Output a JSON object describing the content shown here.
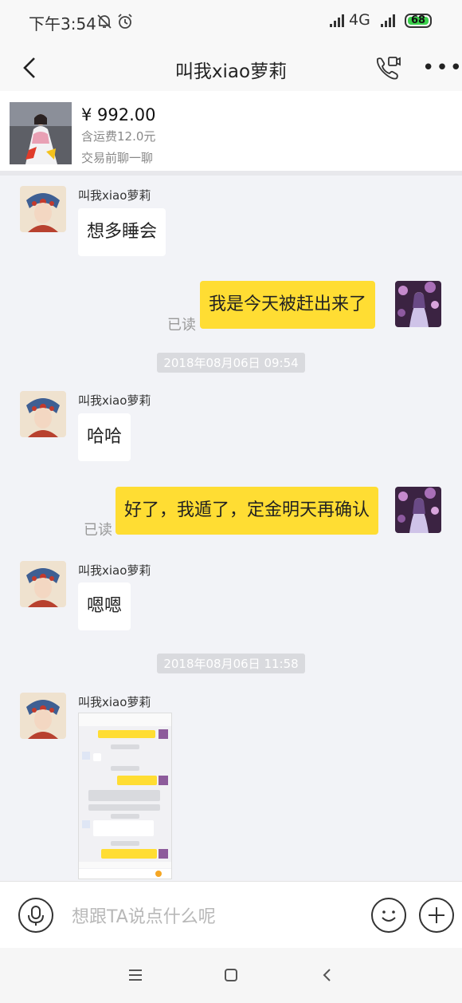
{
  "status_bar": {
    "time": "下午3:54",
    "network": "4G",
    "battery": "68"
  },
  "header": {
    "title": "叫我xiao萝莉"
  },
  "product": {
    "price": "¥ 992.00",
    "shipping": "含运费12.0元",
    "prompt": "交易前聊一聊"
  },
  "messages": [
    {
      "from": "other",
      "sender": "叫我xiao萝莉",
      "text": "想多睡会"
    },
    {
      "from": "me",
      "text": "我是今天被赶出来了",
      "status": "已读"
    },
    {
      "timestamp": "2018年08月06日 09:54"
    },
    {
      "from": "other",
      "sender": "叫我xiao萝莉",
      "text": "哈哈"
    },
    {
      "from": "me",
      "text": "好了，我遁了，定金明天再确认",
      "status": "已读"
    },
    {
      "from": "other",
      "sender": "叫我xiao萝莉",
      "text": "嗯嗯"
    },
    {
      "timestamp": "2018年08月06日 11:58"
    },
    {
      "from": "other",
      "sender": "叫我xiao萝莉",
      "type": "image"
    }
  ],
  "input": {
    "placeholder": "想跟TA说点什么呢"
  },
  "colors": {
    "my_bubble": "#ffdd33",
    "their_bubble": "#ffffff",
    "background": "#f2f3f7",
    "battery": "#3bd24c"
  }
}
